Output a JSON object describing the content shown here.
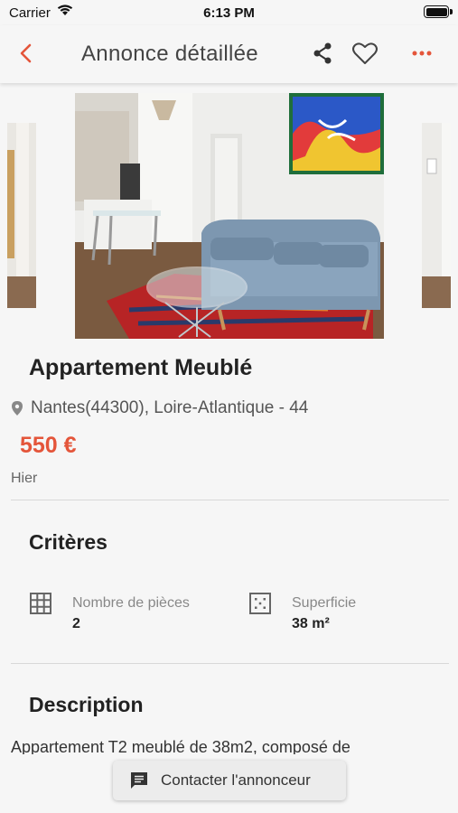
{
  "status_bar": {
    "carrier": "Carrier",
    "time": "6:13 PM"
  },
  "header": {
    "title": "Annonce détaillée",
    "accent_color": "#e4553a",
    "icons": [
      "back-arrow-icon",
      "share-icon",
      "heart-icon",
      "more-icon"
    ]
  },
  "listing": {
    "title": "Appartement Meublé",
    "location": "Nantes(44300), Loire-Atlantique - 44",
    "price": "550 €",
    "date": "Hier",
    "price_color": "#e4553a"
  },
  "criteria": {
    "heading": "Critères",
    "items": [
      {
        "icon": "grid-icon",
        "label": "Nombre de pièces",
        "value": "2"
      },
      {
        "icon": "area-icon",
        "label": "Superficie",
        "value": "38 m²"
      }
    ]
  },
  "description": {
    "heading": "Description",
    "text": "Appartement T2 meublé de 38m2, composé de"
  },
  "contact": {
    "label": "Contacter l'annonceur",
    "icon": "chat-icon"
  }
}
